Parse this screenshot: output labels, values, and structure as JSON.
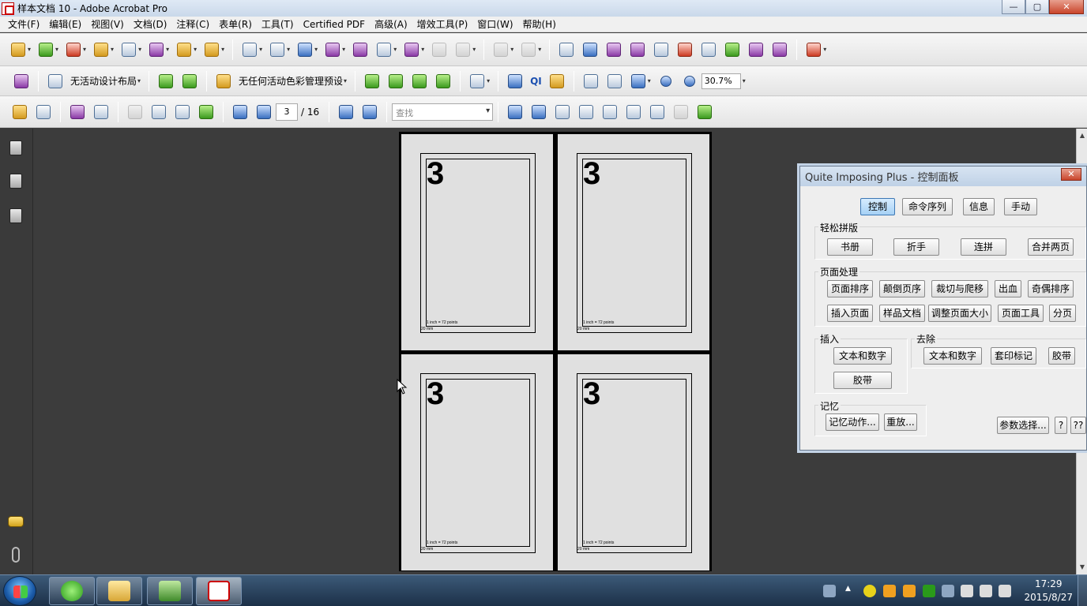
{
  "window": {
    "title": "样本文档 10 - Adobe Acrobat Pro",
    "controls": [
      "—",
      "▢",
      "✕"
    ]
  },
  "menu": [
    "文件(F)",
    "编辑(E)",
    "视图(V)",
    "文档(D)",
    "注释(C)",
    "表单(R)",
    "工具(T)",
    "Certified PDF",
    "高级(A)",
    "增效工具(P)",
    "窗口(W)",
    "帮助(H)"
  ],
  "toolbar2": {
    "design_layout": "无活动设计布局",
    "color_preset": "无任何活动色彩管理预设",
    "qi_label": "QI",
    "zoom": "30.7%"
  },
  "toolbar3": {
    "page_current": "3",
    "page_total": "/ 16",
    "search_placeholder": "查找"
  },
  "pages": [
    {
      "number": "3",
      "note1": "1 inch = 72 points",
      "note2": "20 mm"
    },
    {
      "number": "3",
      "note1": "1 inch = 72 points",
      "note2": "20 mm"
    },
    {
      "number": "3",
      "note1": "1 inch = 72 points",
      "note2": "20 mm"
    },
    {
      "number": "3",
      "note1": "1 inch = 72 points",
      "note2": "20 mm"
    }
  ],
  "panel": {
    "title": "Quite Imposing Plus - 控制面板",
    "close": "✕",
    "tabs": [
      "控制",
      "命令序列",
      "信息",
      "手动"
    ],
    "easy_impose": {
      "label": "轻松拼版",
      "buttons": [
        "书册",
        "折手",
        "连拼",
        "合并两页"
      ]
    },
    "page_handling": {
      "label": "页面处理",
      "row1": [
        "页面排序",
        "颠倒页序",
        "裁切与爬移",
        "出血",
        "奇偶排序"
      ],
      "row2": [
        "插入页面",
        "样品文档",
        "调整页面大小",
        "页面工具",
        "分页"
      ]
    },
    "insert": {
      "label": "插入",
      "buttons": [
        "文本和数字",
        "胶带"
      ]
    },
    "remove": {
      "label": "去除",
      "buttons": [
        "文本和数字",
        "套印标记",
        "胶带"
      ]
    },
    "memory": {
      "label": "记忆",
      "buttons": [
        "记忆动作...",
        "重放..."
      ]
    },
    "prefs": "参数选择...",
    "help1": "?",
    "help2": "??"
  },
  "taskbar": {
    "time": "17:29",
    "date": "2015/8/27"
  },
  "colors": {
    "doc_bg": "#3c3c3c",
    "page_bg": "#e0e0e0",
    "panel_active": "#a6d1f5"
  }
}
